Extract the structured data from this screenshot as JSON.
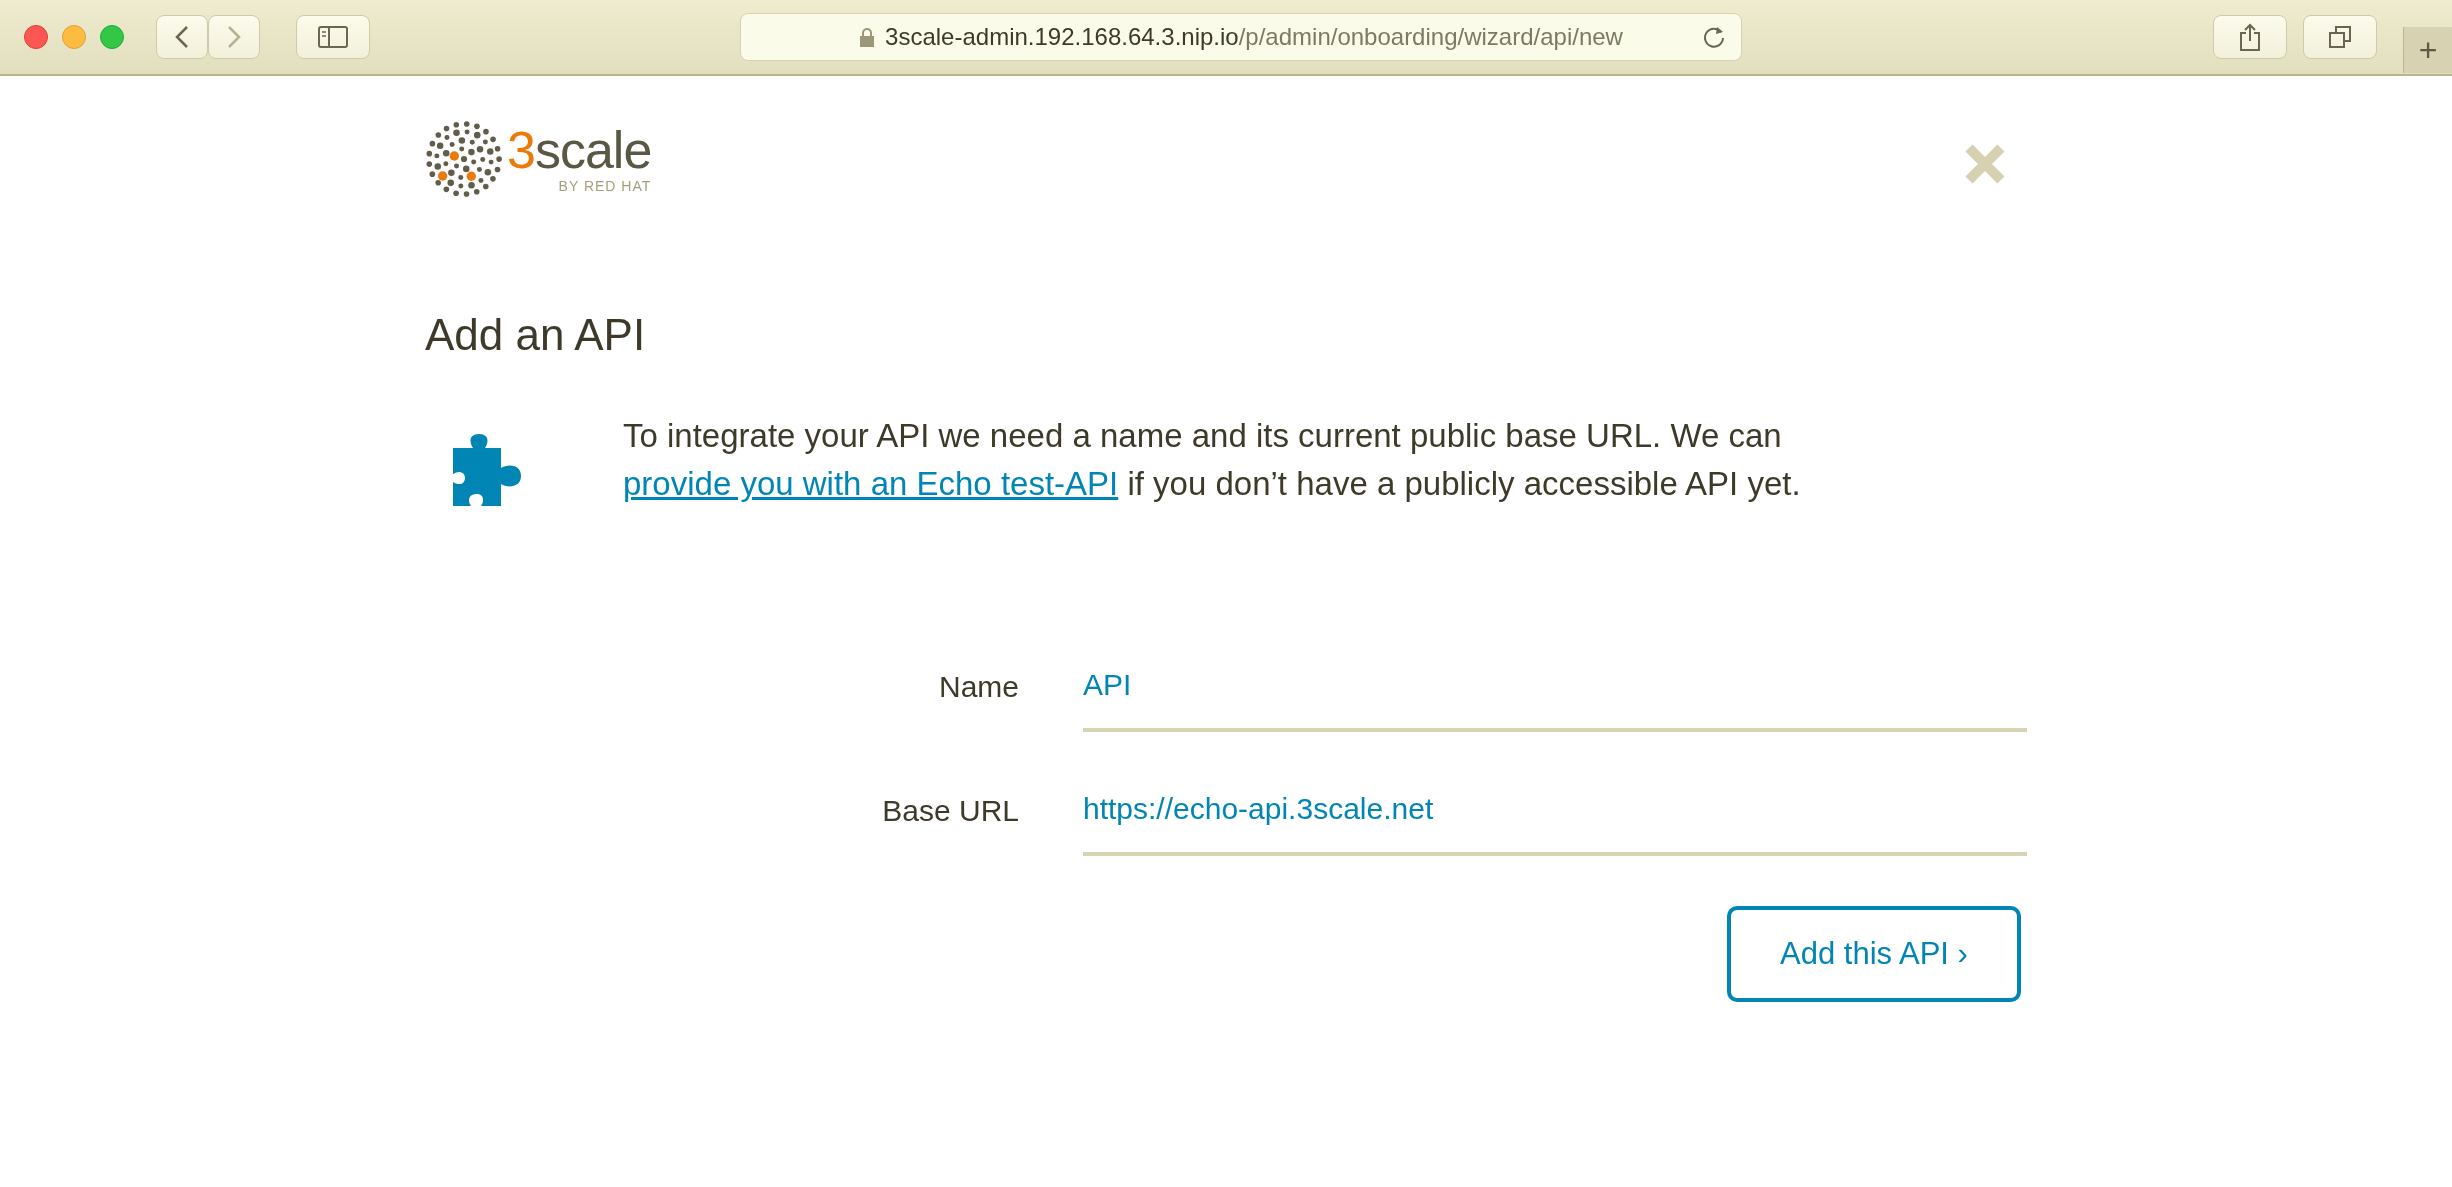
{
  "browser": {
    "address_host": "3scale-admin.192.168.64.3.nip.io",
    "address_path": "/p/admin/onboarding/wizard/api/new",
    "new_tab": "+"
  },
  "logo": {
    "accent": "3",
    "word": "scale",
    "byline": "BY RED HAT"
  },
  "title": "Add an API",
  "intro": {
    "before": "To integrate your API we need a name and its current public base URL. We can ",
    "link": "provide you with an Echo test-API",
    "after": " if you don’t have a publicly accessible API yet."
  },
  "fields": [
    {
      "label": "Name",
      "value": "API"
    },
    {
      "label": "Base URL",
      "value": "https://echo-api.3scale.net"
    }
  ],
  "submit": "Add this API ›"
}
